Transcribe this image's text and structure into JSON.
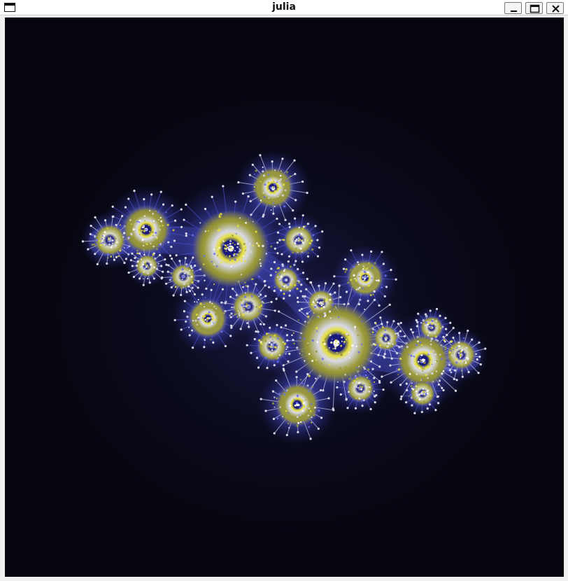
{
  "window": {
    "title": "julia",
    "controls": [
      "minimize",
      "maximize",
      "close"
    ]
  },
  "fractal": {
    "background_color": "#05050d",
    "glow_color": "#5558d8",
    "palette": [
      "#4a4fc8",
      "#8a8a2a",
      "#d8d8e8",
      "#e6e03a",
      "#1a1a7a",
      "#ffffff"
    ]
  }
}
